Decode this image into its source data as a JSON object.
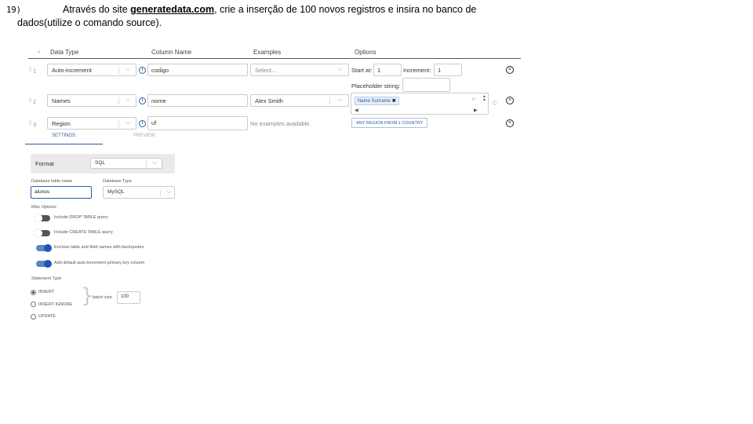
{
  "question": {
    "number": "19)",
    "line1_before": "Através do site ",
    "link_text": "generatedata.com",
    "line1_after": ", crie a inserção de 100 novos registros e insira no banco de",
    "line2": "dados(utilize o comando source)."
  },
  "grid": {
    "headers": {
      "hash": "#",
      "data_type": "Data Type",
      "column_name": "Column Name",
      "examples": "Examples",
      "options": "Options"
    },
    "rows": [
      {
        "num": "1",
        "data_type": "Auto-increment",
        "column_name": "codigo",
        "examples": "Select...",
        "opt_start_label": "Start at:",
        "opt_start_value": "1",
        "opt_inc_label": "Increment:",
        "opt_inc_value": "1",
        "opt_placeholder_label": "Placeholder string:"
      },
      {
        "num": "2",
        "data_type": "Names",
        "column_name": "nome",
        "examples": "Alex Smith",
        "opt_tag": "Name Surname"
      },
      {
        "num": "3",
        "data_type": "Region",
        "column_name": "uf",
        "examples": "No examples available.",
        "opt_button": "ANY REGION FROM 1 COUNTRY"
      }
    ]
  },
  "tabs": {
    "settings": "SETTINGS",
    "preview": "PREVIEW"
  },
  "settings": {
    "format_label": "Format",
    "format_value": "SQL",
    "db_table_label": "Database table name",
    "db_table_value": "alunos",
    "db_type_label": "Database Type",
    "db_type_value": "MySQL",
    "misc_label": "Misc Options",
    "options": [
      {
        "label": "Include DROP TABLE query",
        "on": false
      },
      {
        "label": "Include CREATE TABLE query",
        "on": false
      },
      {
        "label": "Enclose table and field names with backquotes",
        "on": true
      },
      {
        "label": "Add default auto-increment primary key column",
        "on": true
      }
    ],
    "statement_label": "Statement Type",
    "statements": [
      {
        "label": "INSERT",
        "checked": true
      },
      {
        "label": "INSERT IGNORE",
        "checked": false
      },
      {
        "label": "UPDATE",
        "checked": false
      }
    ],
    "batch_label": "batch size",
    "batch_value": "100"
  },
  "colors": {
    "accent": "#2a5ea8",
    "toggle_on": "#1f56b0"
  },
  "icons": [
    "info-icon",
    "chevron-down-icon",
    "remove-row-icon",
    "grip-icon",
    "tag-remove-icon",
    "clear-icon",
    "spinner-icon",
    "copy-icon",
    "scroll-left-icon",
    "scroll-right-icon"
  ]
}
